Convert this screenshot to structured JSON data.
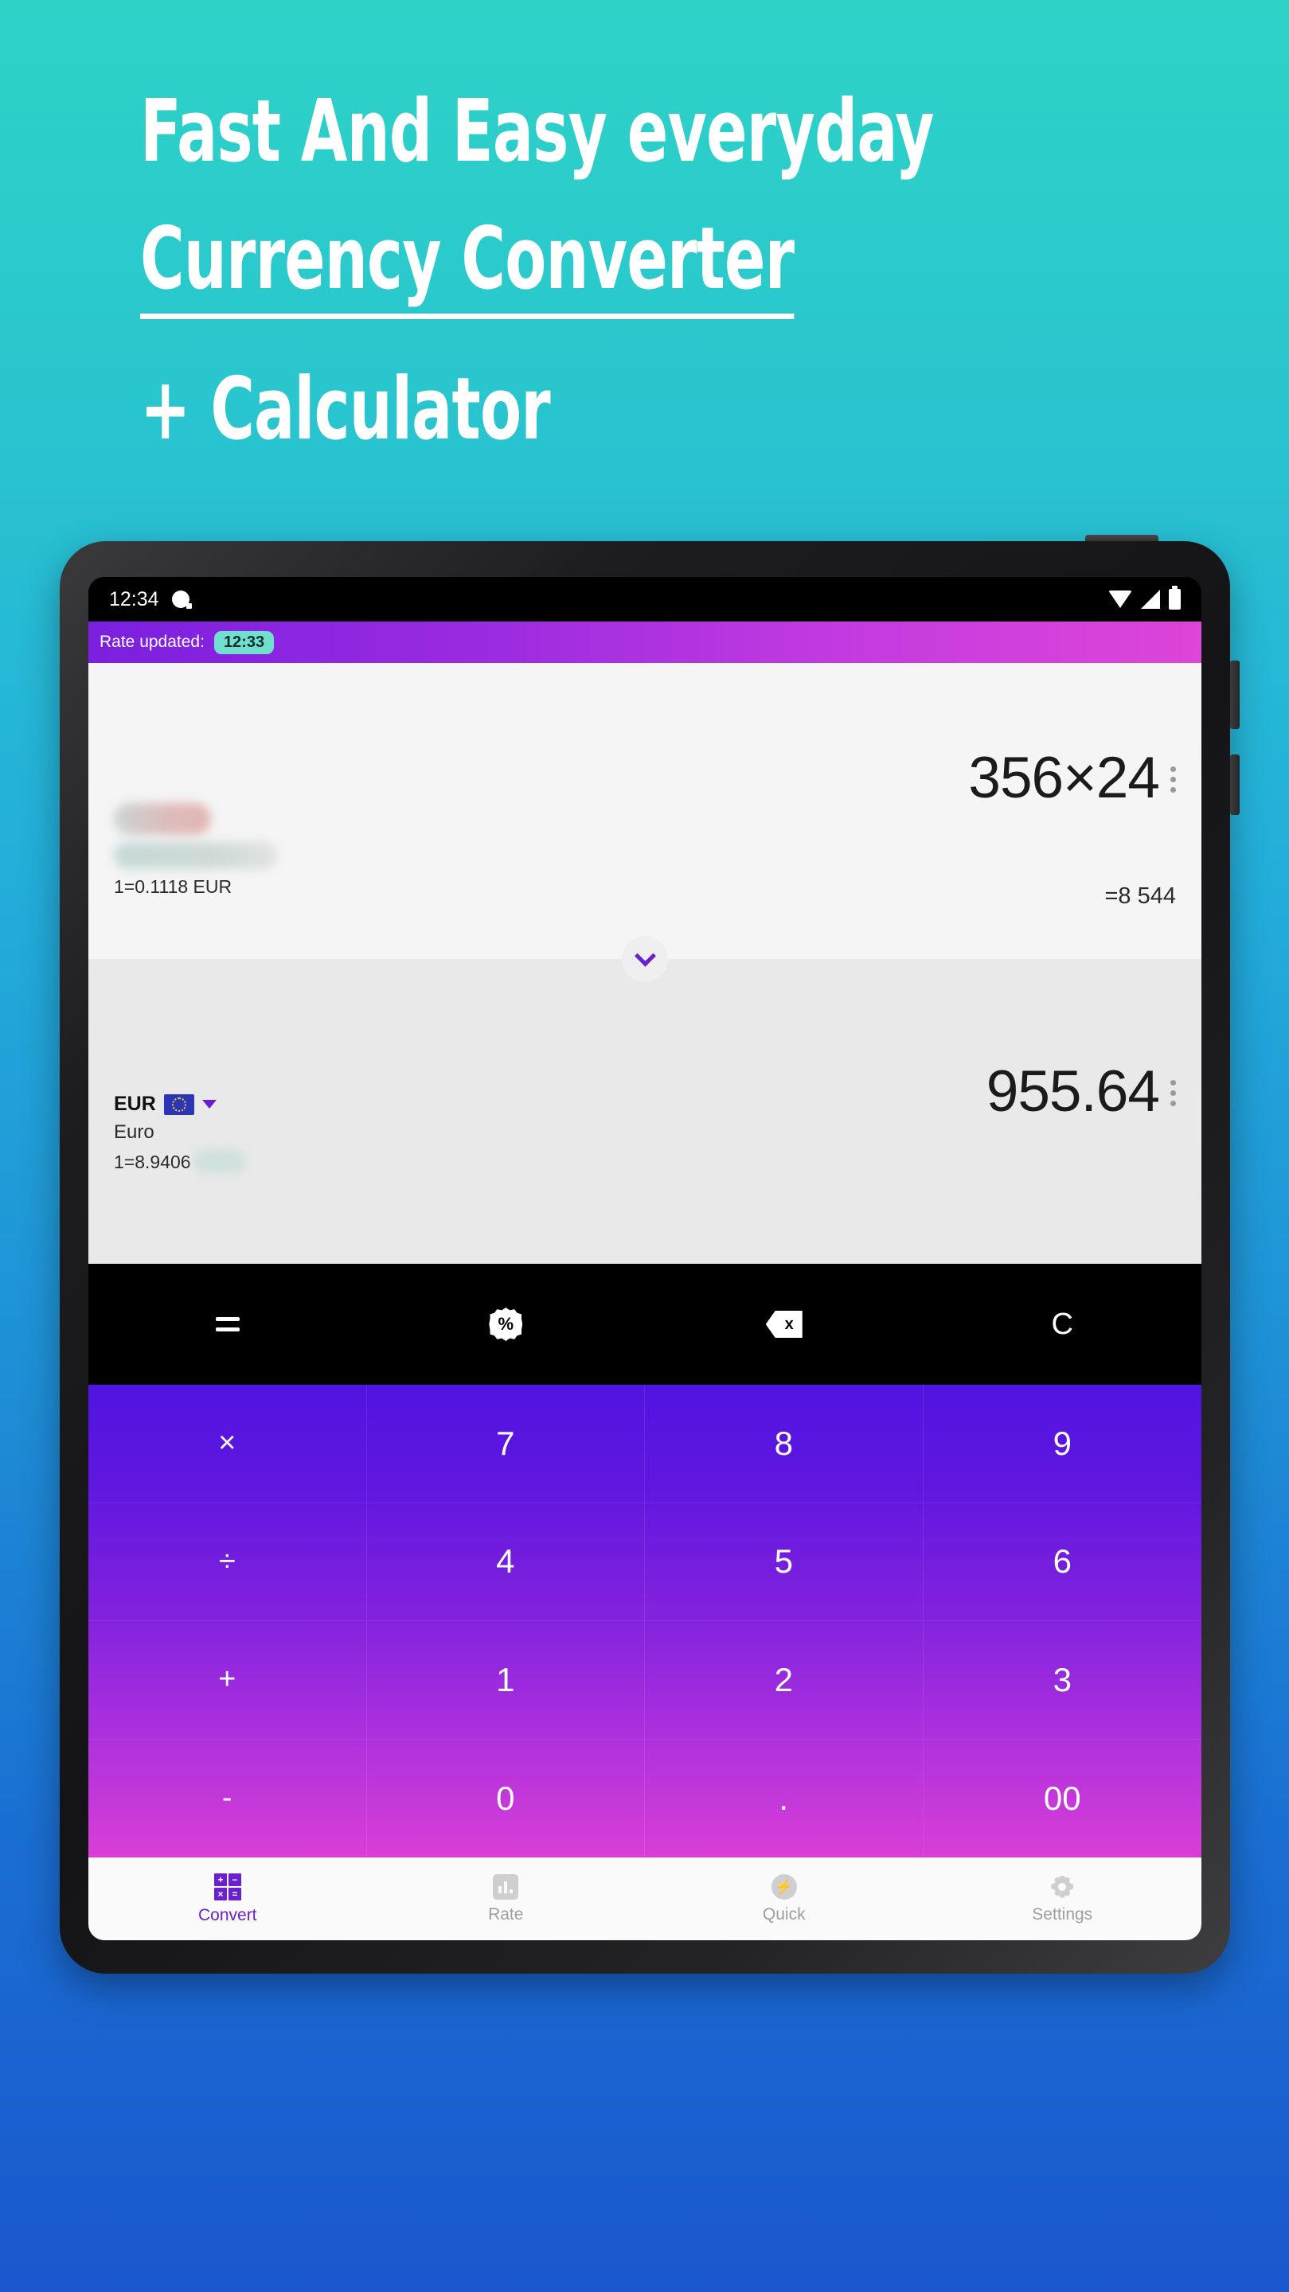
{
  "promo": {
    "line1": "Fast And Easy everyday",
    "line2": "Currency Converter",
    "line3": "+ Calculator"
  },
  "status_bar": {
    "time": "12:34",
    "icons": [
      "notification-icon",
      "wifi-icon",
      "signal-icon",
      "battery-icon"
    ]
  },
  "app_bar": {
    "label": "Rate updated:",
    "badge_time": "12:33",
    "badge_color": "#6FE0D0"
  },
  "converter": {
    "top": {
      "amount": "356×24",
      "result": "=8 544",
      "rate_note": "1=0.1118 EUR",
      "currency_code_redacted": true,
      "currency_name_redacted": true,
      "menu_icon": "kebab-menu-icon"
    },
    "expand_icon": "chevron-down-icon",
    "bottom": {
      "amount": "955.64",
      "currency_code": "EUR",
      "currency_name": "Euro",
      "rate_note_prefix": "1=8.9406",
      "flag_icon": "eu-flag-icon",
      "dropdown_icon": "caret-down-icon",
      "menu_icon": "kebab-menu-icon"
    }
  },
  "function_row": [
    {
      "name": "equals-button",
      "icon": "equals-icon",
      "label": "="
    },
    {
      "name": "percent-button",
      "icon": "percent-icon",
      "label": "%"
    },
    {
      "name": "backspace-button",
      "icon": "backspace-icon",
      "label": "x"
    },
    {
      "name": "clear-button",
      "icon": "clear-icon",
      "label": "C"
    }
  ],
  "keypad": [
    {
      "label": "×",
      "kind": "op"
    },
    {
      "label": "7",
      "kind": "digit"
    },
    {
      "label": "8",
      "kind": "digit"
    },
    {
      "label": "9",
      "kind": "digit"
    },
    {
      "label": "÷",
      "kind": "op"
    },
    {
      "label": "4",
      "kind": "digit"
    },
    {
      "label": "5",
      "kind": "digit"
    },
    {
      "label": "6",
      "kind": "digit"
    },
    {
      "label": "+",
      "kind": "op"
    },
    {
      "label": "1",
      "kind": "digit"
    },
    {
      "label": "2",
      "kind": "digit"
    },
    {
      "label": "3",
      "kind": "digit"
    },
    {
      "label": "-",
      "kind": "op"
    },
    {
      "label": "0",
      "kind": "digit"
    },
    {
      "label": ".",
      "kind": "digit"
    },
    {
      "label": "00",
      "kind": "digit"
    }
  ],
  "bottom_nav": [
    {
      "label": "Convert",
      "icon": "calculator-grid-icon",
      "active": true
    },
    {
      "label": "Rate",
      "icon": "bar-chart-icon",
      "active": false
    },
    {
      "label": "Quick",
      "icon": "lightning-bolt-icon",
      "active": false
    },
    {
      "label": "Settings",
      "icon": "gear-icon",
      "active": false
    }
  ],
  "convert_icon_glyphs": [
    "+",
    "−",
    "×",
    "="
  ],
  "colors": {
    "background_top": "#2ED3C6",
    "background_bottom": "#1A57CE",
    "accent_purple": "#6A1FD0",
    "appbar_start": "#7B1FE0",
    "appbar_end": "#DE45D8",
    "keypad_start": "#5014E0",
    "keypad_end": "#D93ED6"
  }
}
